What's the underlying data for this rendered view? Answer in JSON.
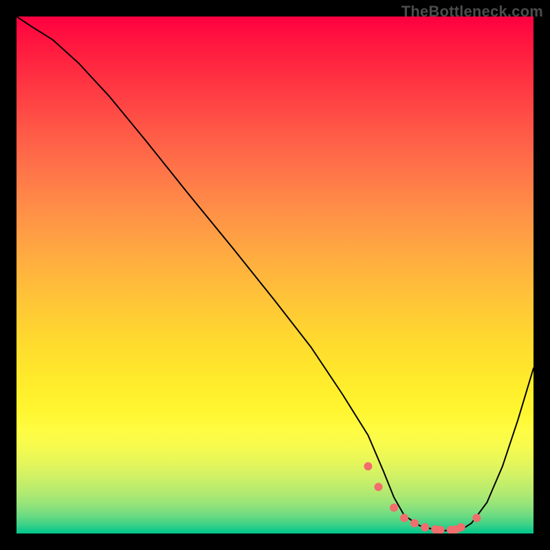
{
  "watermark": "TheBottleneck.com",
  "chart_data": {
    "type": "line",
    "title": "",
    "xlabel": "",
    "ylabel": "",
    "xlim": [
      0,
      100
    ],
    "ylim": [
      0,
      100
    ],
    "grid": false,
    "series": [
      {
        "name": "curve",
        "color": "#000000",
        "x": [
          0,
          3,
          7,
          12,
          18,
          25,
          33,
          42,
          50,
          57,
          63,
          68,
          71,
          73,
          75,
          78,
          81,
          84,
          86,
          88,
          91,
          94,
          97,
          100
        ],
        "y": [
          100,
          98,
          95.5,
          91,
          84.5,
          76,
          66,
          55,
          45,
          36,
          27,
          19,
          12,
          7,
          3.5,
          1.5,
          0.7,
          0.5,
          0.7,
          2,
          6,
          13,
          22,
          32
        ]
      },
      {
        "name": "highlight-dots",
        "color": "#f26d6d",
        "x": [
          68,
          70,
          73,
          75,
          77,
          79,
          81,
          82,
          84,
          85,
          86,
          89
        ],
        "y": [
          13,
          9,
          5,
          3,
          2,
          1.2,
          0.8,
          0.7,
          0.7,
          0.8,
          1.2,
          3
        ]
      }
    ],
    "background_gradient": {
      "top": "#ff0040",
      "bottom": "#00c78b",
      "stops": [
        "red",
        "orange",
        "yellow",
        "green"
      ]
    }
  }
}
